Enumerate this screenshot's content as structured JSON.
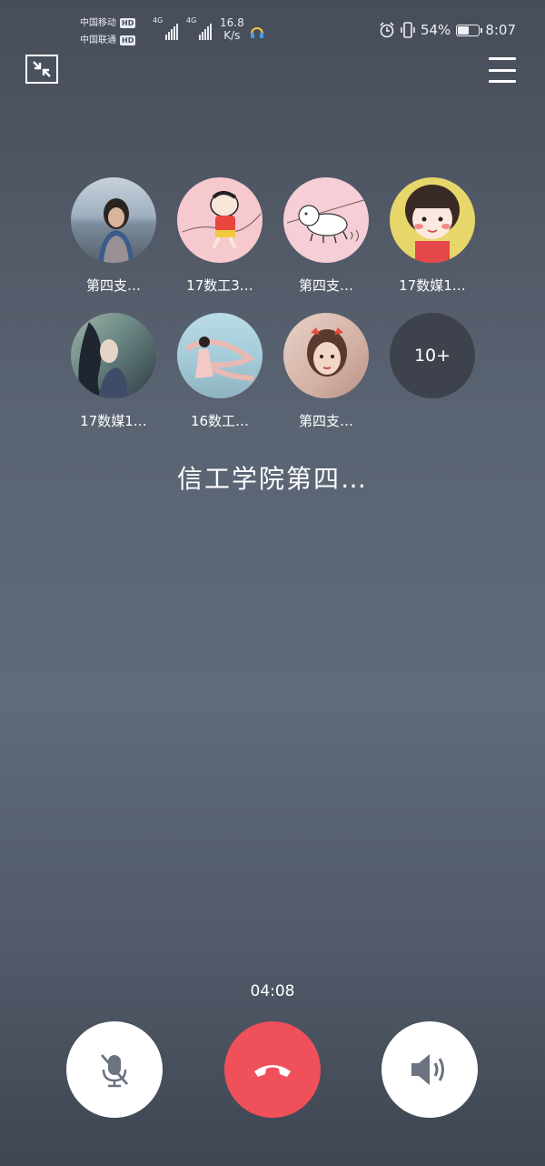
{
  "status_bar": {
    "carrier_1": "中国移动",
    "carrier_2": "中国联通",
    "hd_badge": "HD",
    "network_type": "4G",
    "net_speed_value": "16.8",
    "net_speed_unit": "K/s",
    "battery_percent": "54%",
    "battery_level": 0.54,
    "time": "8:07"
  },
  "call": {
    "members": [
      {
        "name": "第四支…",
        "avatar": "photo-woman-by-lake"
      },
      {
        "name": "17数工3…",
        "avatar": "cartoon-boy-running"
      },
      {
        "name": "第四支…",
        "avatar": "cartoon-white-dog"
      },
      {
        "name": "17数媒1…",
        "avatar": "cartoon-girl-portrait"
      },
      {
        "name": "17数媒1…",
        "avatar": "photo-woman-in-forest"
      },
      {
        "name": "16数工…",
        "avatar": "photo-woman-with-ribbon"
      },
      {
        "name": "第四支…",
        "avatar": "photo-woman-with-bow"
      }
    ],
    "more_count": "10+",
    "group_name": "信工学院第四…",
    "duration": "04:08"
  },
  "colors": {
    "hangup": "#f0505a",
    "control_bg": "#ffffff",
    "icon_gray": "#6b7280"
  }
}
